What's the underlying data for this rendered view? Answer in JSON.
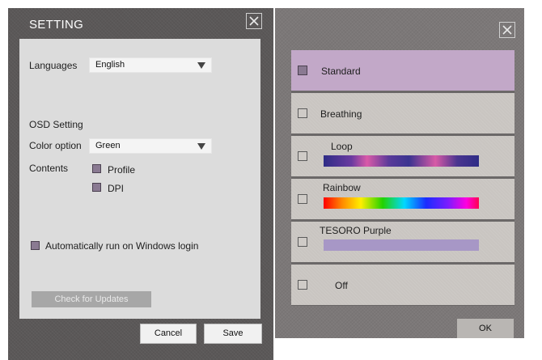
{
  "settings": {
    "title": "SETTING",
    "languages_label": "Languages",
    "language_value": "English",
    "osd_label": "OSD Setting",
    "color_label": "Color option",
    "color_value": "Green",
    "contents_label": "Contents",
    "profile_label": "Profile",
    "dpi_label": "DPI",
    "autorun_label": "Automatically run on Windows login",
    "update_button": "Check for Updates",
    "cancel_button": "Cancel",
    "save_button": "Save"
  },
  "lighting": {
    "modes": [
      {
        "label": "Standard",
        "selected": true
      },
      {
        "label": "Breathing",
        "selected": false
      },
      {
        "label": "Loop",
        "selected": false
      },
      {
        "label": "Rainbow",
        "selected": false
      },
      {
        "label": "TESORO Purple",
        "selected": false
      },
      {
        "label": "Off",
        "selected": false
      }
    ],
    "ok_button": "OK"
  },
  "colors": {
    "checkbox_fill": "#8a7a92",
    "selected_row": "#c2a8c8",
    "purple_bar": "#a797c6"
  },
  "icons": {
    "close": "close-icon",
    "dropdown": "dropdown-arrow-icon"
  }
}
